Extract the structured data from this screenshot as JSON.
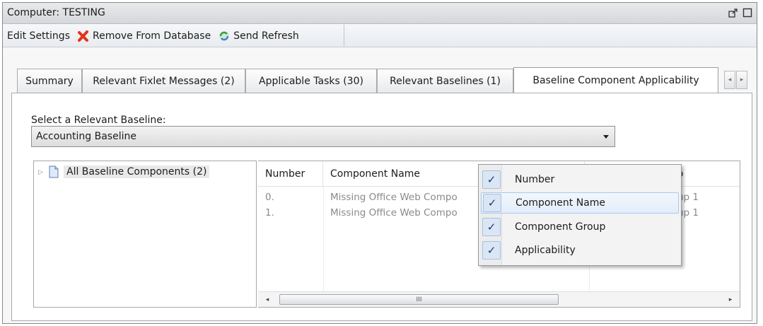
{
  "window": {
    "title": "Computer: TESTING"
  },
  "toolbar": {
    "edit_settings": "Edit Settings",
    "remove_from_database": "Remove From Database",
    "send_refresh": "Send Refresh"
  },
  "tabs": [
    {
      "label": "Summary"
    },
    {
      "label": "Relevant Fixlet Messages (2)"
    },
    {
      "label": "Applicable Tasks (30)"
    },
    {
      "label": "Relevant Baselines (1)"
    },
    {
      "label": "Baseline Component Applicability"
    }
  ],
  "panel": {
    "select_label": "Select a Relevant Baseline:",
    "selected_baseline": "Accounting Baseline"
  },
  "tree": {
    "root_label": "All Baseline Components (2)"
  },
  "grid": {
    "columns": [
      "Number",
      "Component Name",
      "oup"
    ],
    "rows": [
      {
        "number": "0.",
        "name": "Missing Office Web Compo",
        "group": "up 1"
      },
      {
        "number": "1.",
        "name": "Missing Office Web Compo",
        "group": "up 1"
      }
    ],
    "scroll_thumb": "III"
  },
  "context_menu": {
    "items": [
      {
        "label": "Number",
        "checked": true
      },
      {
        "label": "Component Name",
        "checked": true
      },
      {
        "label": "Component Group",
        "checked": true
      },
      {
        "label": "Applicability",
        "checked": true
      }
    ],
    "check_glyph": "✓"
  },
  "colors": {
    "remove_icon": "#e0361b",
    "refresh_icon": "#3aa84a",
    "menu_highlight": "#a8c8ec"
  }
}
